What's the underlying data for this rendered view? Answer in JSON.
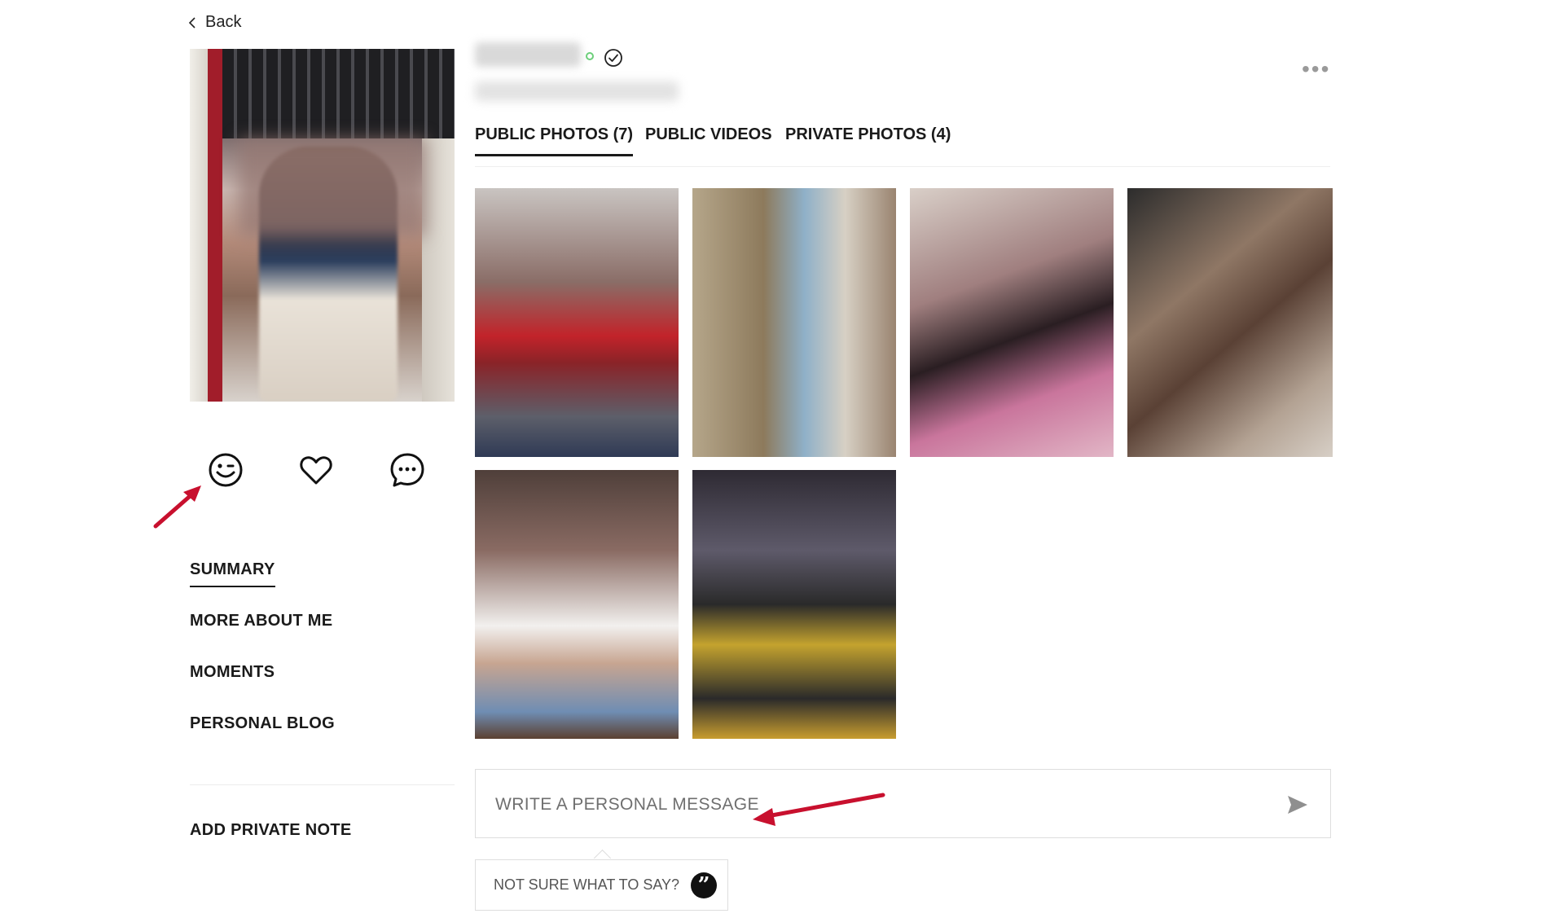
{
  "header": {
    "back_label": "Back",
    "more_label": "•••",
    "online_status": "online",
    "verified_icon": "check-circle-icon"
  },
  "tabs": [
    {
      "label": "PUBLIC PHOTOS (7)",
      "active": true
    },
    {
      "label": "PUBLIC VIDEOS",
      "active": false
    },
    {
      "label": "PRIVATE PHOTOS (4)",
      "active": false
    }
  ],
  "actions": [
    {
      "name": "wink",
      "icon": "wink-icon"
    },
    {
      "name": "favorite",
      "icon": "heart-icon"
    },
    {
      "name": "chat",
      "icon": "chat-bubble-icon"
    }
  ],
  "nav": [
    {
      "label": "SUMMARY",
      "active": true
    },
    {
      "label": "MORE ABOUT ME",
      "active": false
    },
    {
      "label": "MOMENTS",
      "active": false
    },
    {
      "label": "PERSONAL BLOG",
      "active": false
    }
  ],
  "private_note_label": "ADD PRIVATE NOTE",
  "message": {
    "placeholder": "WRITE A PERSONAL MESSAGE",
    "value": "",
    "send_icon": "send-icon"
  },
  "suggestion": {
    "label": "NOT SURE WHAT TO SAY?",
    "icon": "quote-icon"
  },
  "annotation_color": "#c8102e"
}
